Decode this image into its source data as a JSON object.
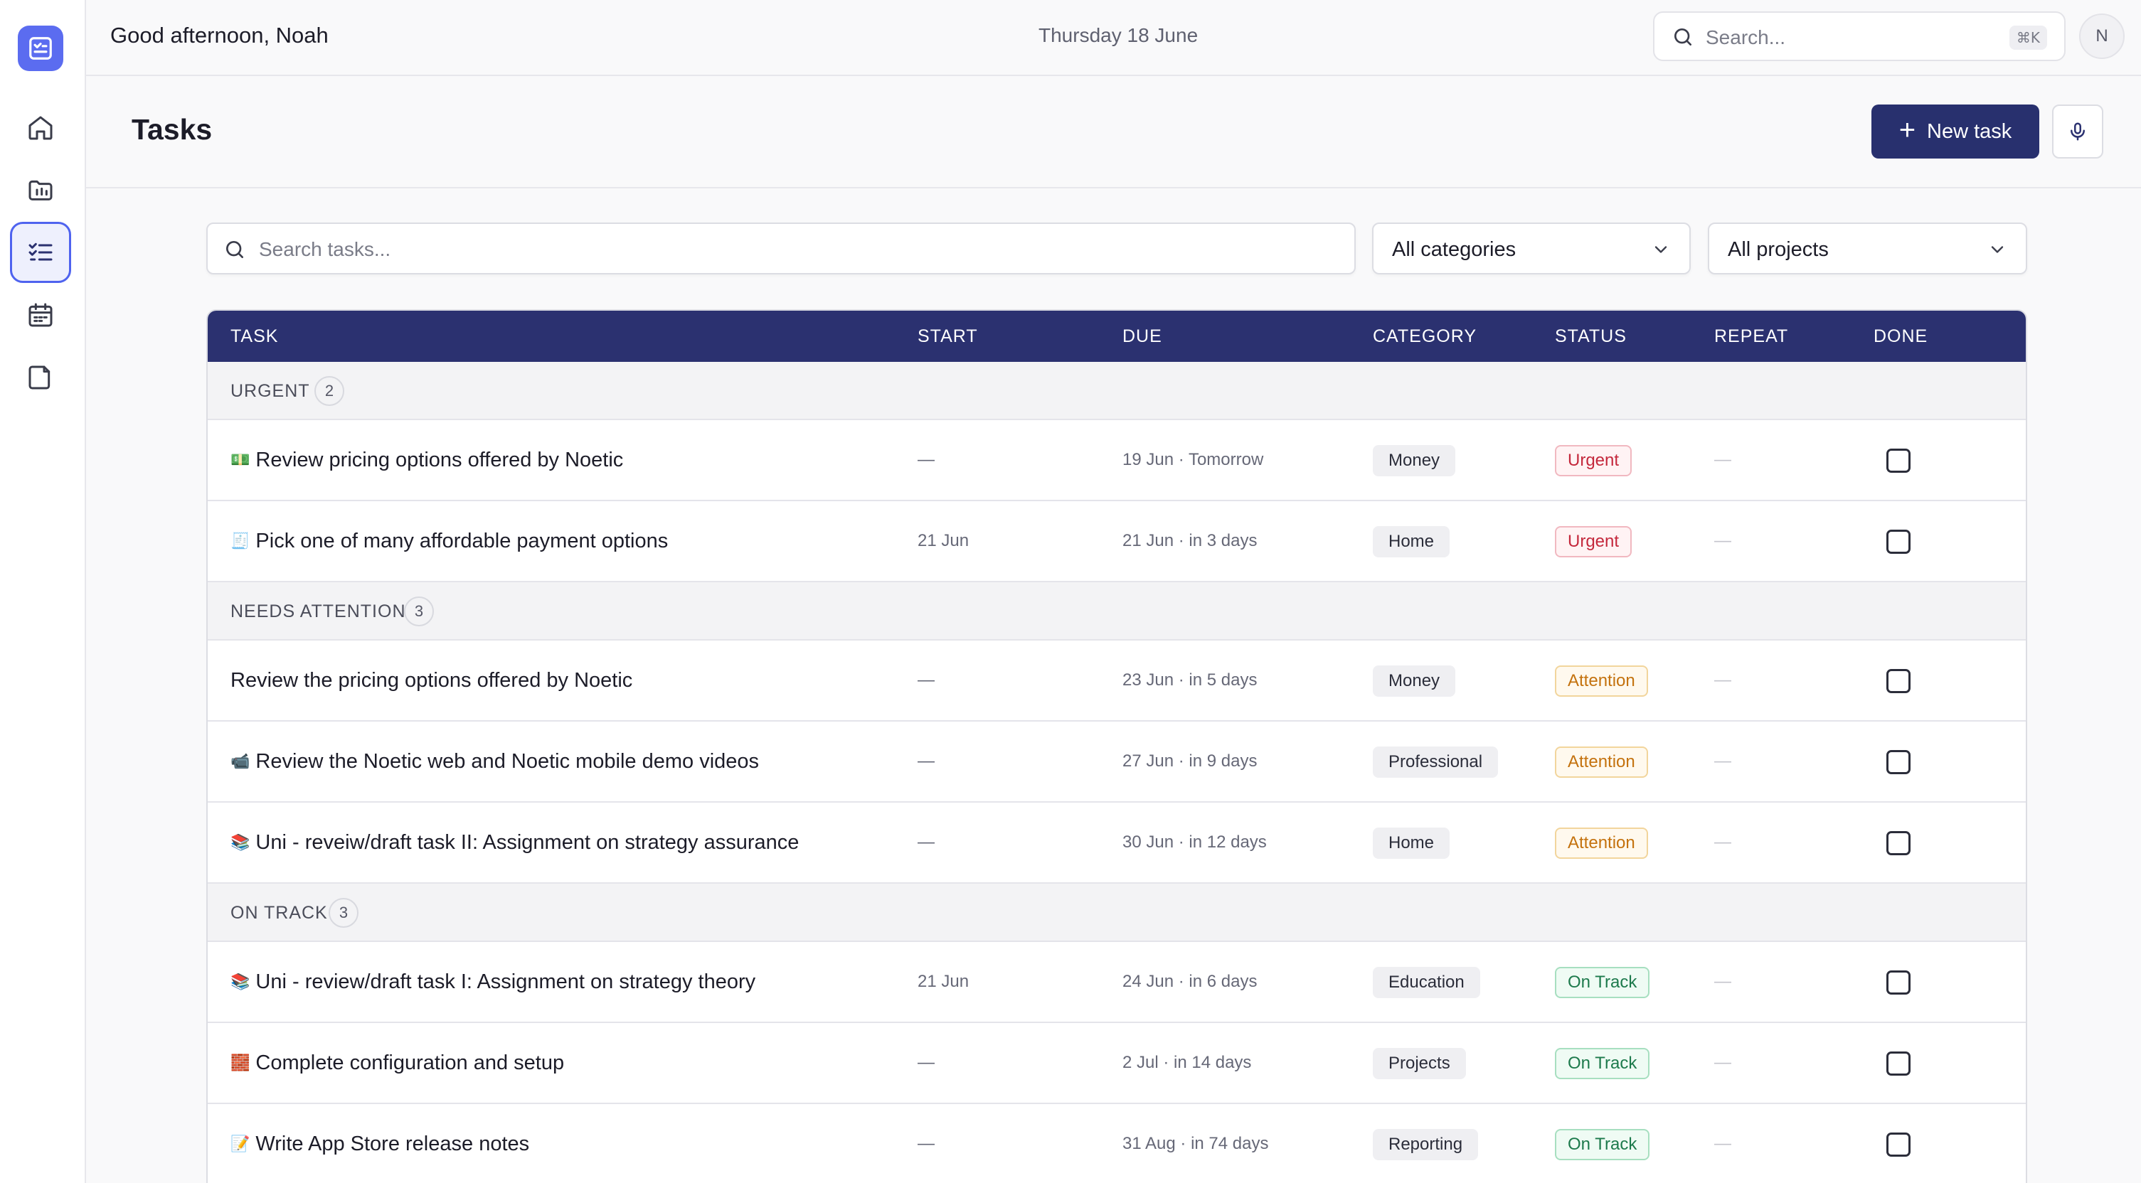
{
  "header": {
    "greeting": "Good afternoon, Noah",
    "date": "Thursday 18 June",
    "search_placeholder": "Search...",
    "search_shortcut": "⌘K",
    "avatar_initial": "N"
  },
  "sidebar": {
    "items": [
      {
        "icon": "home-icon"
      },
      {
        "icon": "projects-icon"
      },
      {
        "icon": "tasks-icon",
        "active": true
      },
      {
        "icon": "calendar-icon"
      },
      {
        "icon": "notes-icon"
      }
    ]
  },
  "page": {
    "title": "Tasks",
    "new_task_label": "New task"
  },
  "filters": {
    "search_placeholder": "Search tasks...",
    "category": "All categories",
    "project": "All projects"
  },
  "table": {
    "columns": {
      "task": "TASK",
      "start": "START",
      "due": "DUE",
      "category": "CATEGORY",
      "status": "STATUS",
      "repeat": "REPEAT",
      "done": "DONE"
    },
    "groups": [
      {
        "label": "URGENT",
        "count": "2",
        "rows": [
          {
            "emoji": "💵",
            "task": "Review pricing options offered by Noetic",
            "start": "—",
            "due": "19 Jun · Tomorrow",
            "category": "Money",
            "status": "Urgent",
            "repeat": "—"
          },
          {
            "emoji": "🧾",
            "task": "Pick one of many affordable payment options",
            "start": "21 Jun",
            "due": "21 Jun · in 3 days",
            "category": "Home",
            "status": "Urgent",
            "repeat": "—"
          }
        ]
      },
      {
        "label": "NEEDS ATTENTION",
        "count": "3",
        "rows": [
          {
            "emoji": "",
            "task": "Review the pricing options offered by Noetic",
            "start": "—",
            "due": "23 Jun · in 5 days",
            "category": "Money",
            "status": "Attention",
            "repeat": "—"
          },
          {
            "emoji": "📹",
            "task": "Review the Noetic web and Noetic mobile demo videos",
            "start": "—",
            "due": "27 Jun · in 9 days",
            "category": "Professional",
            "status": "Attention",
            "repeat": "—"
          },
          {
            "emoji": "📚",
            "task": "Uni - reveiw/draft task II: Assignment on strategy assurance",
            "start": "—",
            "due": "30 Jun · in 12 days",
            "category": "Home",
            "status": "Attention",
            "repeat": "—"
          }
        ]
      },
      {
        "label": "ON TRACK",
        "count": "3",
        "rows": [
          {
            "emoji": "📚",
            "task": "Uni - review/draft task I: Assignment on strategy theory",
            "start": "21 Jun",
            "due": "24 Jun · in 6 days",
            "category": "Education",
            "status": "On Track",
            "repeat": "—"
          },
          {
            "emoji": "🧱",
            "task": "Complete configuration and setup",
            "start": "—",
            "due": "2 Jul · in 14 days",
            "category": "Projects",
            "status": "On Track",
            "repeat": "—"
          },
          {
            "emoji": "📝",
            "task": "Write App Store release notes",
            "start": "—",
            "due": "31 Aug · in 74 days",
            "category": "Reporting",
            "status": "On Track",
            "repeat": "—"
          }
        ]
      }
    ]
  },
  "colors": {
    "accent": "#5b6cf0",
    "header_navy": "#2b3170",
    "button_navy": "#28306e"
  }
}
